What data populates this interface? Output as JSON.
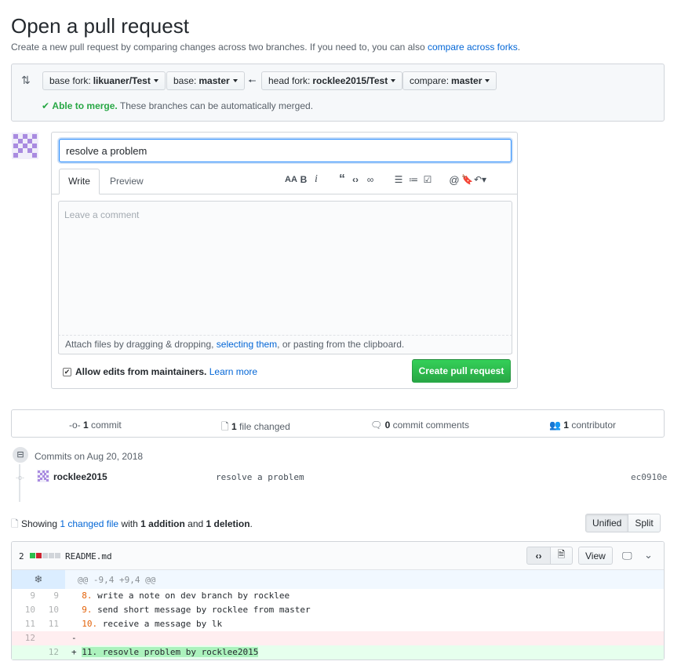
{
  "page": {
    "title": "Open a pull request",
    "subtitle": "Create a new pull request by comparing changes across two branches. If you need to, you can also",
    "subtitle_link": "compare across forks",
    "subtitle_end": "."
  },
  "compare": {
    "base_fork_label": "base fork:",
    "base_fork_value": "likuaner/Test",
    "base_label": "base:",
    "base_value": "master",
    "head_fork_label": "head fork:",
    "head_fork_value": "rocklee2015/Test",
    "compare_label": "compare:",
    "compare_value": "master",
    "merge_status": "Able to merge.",
    "merge_detail": "These branches can be automatically merged."
  },
  "form": {
    "title_value": "resolve a problem",
    "tab_write": "Write",
    "tab_preview": "Preview",
    "comment_placeholder": "Leave a comment",
    "attach_prefix": "Attach files by dragging & dropping,",
    "attach_link": "selecting them",
    "attach_suffix": ", or pasting from the clipboard.",
    "allow_edits": "Allow edits from maintainers.",
    "learn_more": "Learn more",
    "submit": "Create pull request",
    "toolbar": {
      "heading": "AA",
      "bold": "B",
      "italic": "i"
    }
  },
  "stats": {
    "commits_count": "1",
    "commits_label": "commit",
    "files_count": "1",
    "files_label": "file changed",
    "comments_count": "0",
    "comments_label": "commit comments",
    "contributors_count": "1",
    "contributors_label": "contributor"
  },
  "commits": {
    "date_heading": "Commits on Aug 20, 2018",
    "items": [
      {
        "author": "rocklee2015",
        "message": "resolve a problem",
        "sha": "ec0910e"
      }
    ]
  },
  "summary": {
    "showing": "Showing",
    "changed_link": "1 changed file",
    "with": "with",
    "additions": "1 addition",
    "and": "and",
    "deletions": "1 deletion",
    "end": ".",
    "unified": "Unified",
    "split": "Split"
  },
  "file": {
    "change_count": "2",
    "name": "README.md",
    "view_button": "View",
    "hunk": "@@ -9,4 +9,4 @@",
    "lines": [
      {
        "old": "9",
        "new": "9",
        "sign": " ",
        "num": "8.",
        "text": "write a note on dev branch by rocklee",
        "type": "ctx"
      },
      {
        "old": "10",
        "new": "10",
        "sign": " ",
        "num": "9.",
        "text": "send short message by rocklee from master",
        "type": "ctx"
      },
      {
        "old": "11",
        "new": "11",
        "sign": " ",
        "num": "10.",
        "text": "receive a message by lk",
        "type": "ctx"
      },
      {
        "old": "12",
        "new": "",
        "sign": "-",
        "num": "",
        "text": "",
        "type": "del"
      },
      {
        "old": "",
        "new": "12",
        "sign": "+",
        "num": "",
        "text": "11. resovle problem by rocklee2015",
        "type": "add"
      }
    ]
  },
  "colors": {
    "link": "#0366d6",
    "green": "#28a745",
    "added_bg": "#e6ffed",
    "deleted_bg": "#ffeef0",
    "hunk_bg": "#f1f8ff"
  }
}
